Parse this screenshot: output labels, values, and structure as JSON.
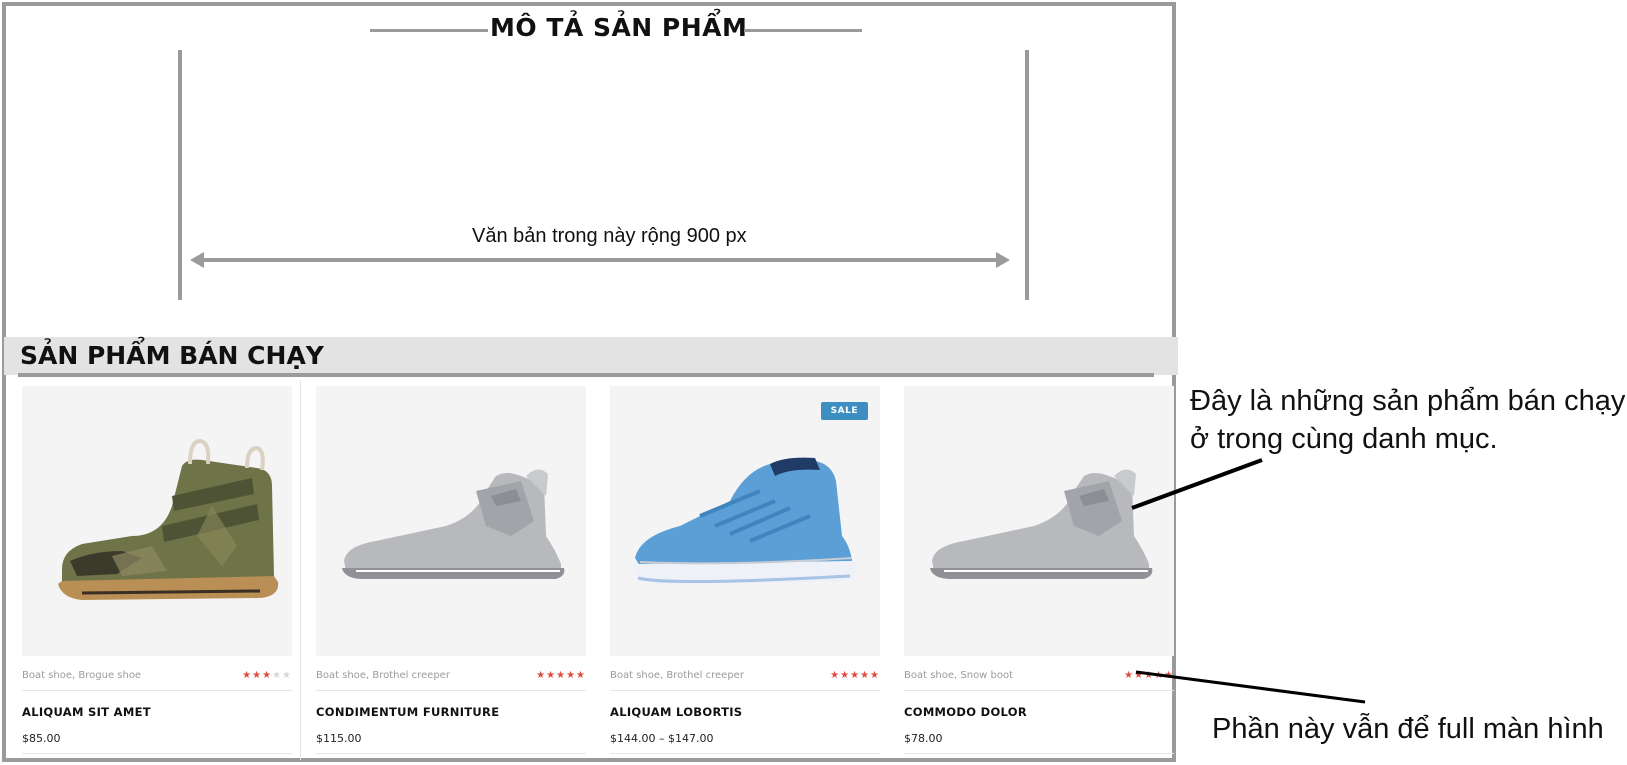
{
  "description": {
    "title": "MÔ TẢ SẢN PHẨM",
    "width_label": "Văn bản trong này rộng 900 px"
  },
  "best_sellers": {
    "title": "SẢN PHẨM BÁN CHẠY",
    "products": [
      {
        "categories": "Boat shoe, Brogue shoe",
        "rating": 3,
        "name": "ALIQUAM SIT AMET",
        "price": "$85.00",
        "badge": "",
        "image": "camo-high-top-shoe"
      },
      {
        "categories": "Boat shoe, Brothel creeper",
        "rating": 5,
        "name": "CONDIMENTUM FURNITURE",
        "price": "$115.00",
        "badge": "",
        "image": "grey-sneaker"
      },
      {
        "categories": "Boat shoe, Brothel creeper",
        "rating": 5,
        "name": "ALIQUAM LOBORTIS",
        "price": "$144.00 – $147.00",
        "badge": "SALE",
        "image": "blue-basketball-shoe"
      },
      {
        "categories": "Boat shoe, Snow boot",
        "rating": 5,
        "name": "COMMODO DOLOR",
        "price": "$78.00",
        "badge": "",
        "image": "grey-sneaker"
      }
    ]
  },
  "annotations": {
    "note_line1": "Đây là những sản phẩm bán chạy",
    "note_line2": "ở trong cùng danh mục.",
    "note_full": "Phần này vẫn để full màn hình"
  },
  "colors": {
    "frame": "#9a9a9a",
    "star": "#e24b3c",
    "sale_badge": "#3d8fc1",
    "bar": "#e3e3e3"
  }
}
